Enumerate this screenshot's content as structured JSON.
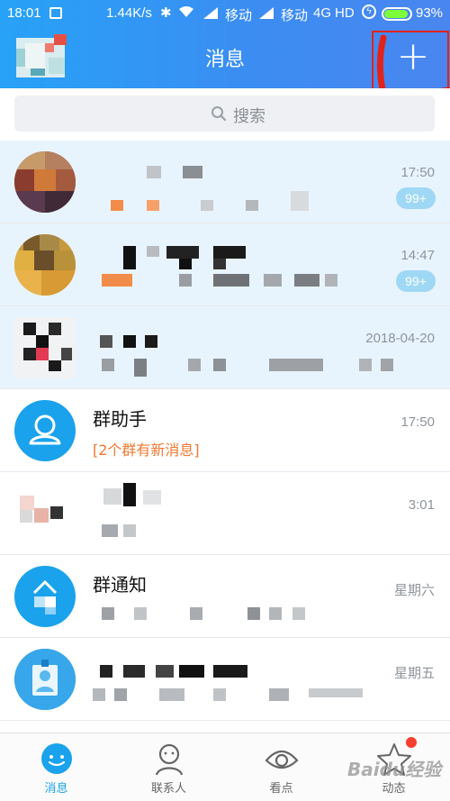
{
  "status_bar": {
    "time": "18:01",
    "network_speed": "1.44K/s",
    "carrier1": "移动",
    "carrier2": "移动",
    "network_type": "4G",
    "hd": "HD",
    "battery": "93%"
  },
  "header": {
    "title": "消息",
    "add_label": "+"
  },
  "search": {
    "placeholder": "搜索"
  },
  "conversations": [
    {
      "name": "",
      "time": "17:50",
      "badge": "99+"
    },
    {
      "name": "",
      "time": "14:47",
      "badge": "99+"
    },
    {
      "name": "",
      "time": "2018-04-20"
    },
    {
      "name": "群助手",
      "subtitle": "[2个群有新消息]",
      "time": "17:50"
    },
    {
      "name": "",
      "time": "3:01"
    },
    {
      "name": "群通知",
      "time": "星期六"
    },
    {
      "name": "",
      "time": "星期五"
    }
  ],
  "tabbar": {
    "items": [
      {
        "label": "消息",
        "icon": "chat-bubble-icon",
        "active": true
      },
      {
        "label": "联系人",
        "icon": "contacts-icon"
      },
      {
        "label": "看点",
        "icon": "eye-icon"
      },
      {
        "label": "动态",
        "icon": "star-icon"
      }
    ]
  },
  "watermark": "Baidu经验",
  "colors": {
    "header_blue": "#3b8df2",
    "accent": "#1aa2ec",
    "badge": "#9fd8f5",
    "highlight_red": "#e2231a",
    "notice_orange": "#f0782e"
  }
}
